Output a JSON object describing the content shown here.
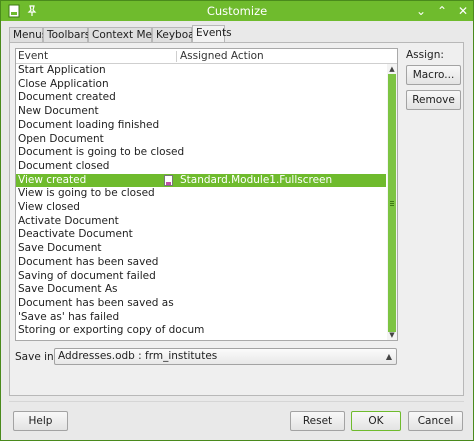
{
  "window": {
    "title": "Customize"
  },
  "tabs": [
    {
      "label": "Menus"
    },
    {
      "label": "Toolbars"
    },
    {
      "label": "Context Menus"
    },
    {
      "label": "Keyboard"
    },
    {
      "label": "Events",
      "active": true
    }
  ],
  "table": {
    "headers": {
      "event": "Event",
      "action": "Assigned Action"
    },
    "rows": [
      {
        "event": "Start Application",
        "action": ""
      },
      {
        "event": "Close Application",
        "action": ""
      },
      {
        "event": "Document created",
        "action": ""
      },
      {
        "event": "New Document",
        "action": ""
      },
      {
        "event": "Document loading finished",
        "action": ""
      },
      {
        "event": "Open Document",
        "action": ""
      },
      {
        "event": "Document is going to be closed",
        "action": ""
      },
      {
        "event": "Document closed",
        "action": ""
      },
      {
        "event": "View created",
        "action": "Standard.Module1.Fullscreen",
        "selected": true
      },
      {
        "event": "View is going to be closed",
        "action": ""
      },
      {
        "event": "View closed",
        "action": ""
      },
      {
        "event": "Activate Document",
        "action": ""
      },
      {
        "event": "Deactivate Document",
        "action": ""
      },
      {
        "event": "Save Document",
        "action": ""
      },
      {
        "event": "Document has been saved",
        "action": ""
      },
      {
        "event": "Saving of document failed",
        "action": ""
      },
      {
        "event": "Save Document As",
        "action": ""
      },
      {
        "event": "Document has been saved as",
        "action": ""
      },
      {
        "event": "'Save as' has failed",
        "action": ""
      },
      {
        "event": "Storing or exporting copy of docum",
        "action": ""
      }
    ]
  },
  "assign": {
    "label": "Assign:",
    "macro_button": "Macro...",
    "remove_button": "Remove"
  },
  "save_in": {
    "label": "Save in:",
    "value": "Addresses.odb : frm_institutes"
  },
  "footer": {
    "help": "Help",
    "reset": "Reset",
    "ok": "OK",
    "cancel": "Cancel"
  },
  "colors": {
    "accent": "#6fbb2d",
    "selection": "#6fbb2d"
  }
}
